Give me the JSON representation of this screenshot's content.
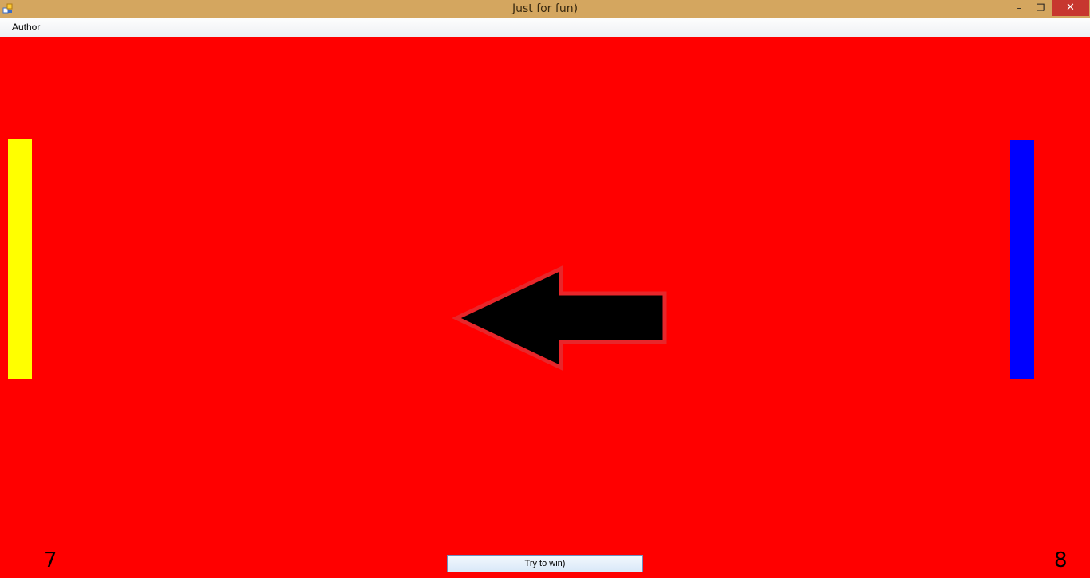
{
  "window": {
    "title": "Just for fun)",
    "controls": {
      "minimize": "–",
      "maximize": "❐",
      "close": "✕"
    }
  },
  "menu": {
    "items": [
      {
        "label": "Author"
      }
    ]
  },
  "game": {
    "background_color": "#ff0000",
    "left_paddle_color": "#ffff00",
    "right_paddle_color": "#0000ff",
    "ball_icon": "arrow-left-icon",
    "score_left": "7",
    "score_right": "8",
    "try_button_label": "Try to win)"
  }
}
